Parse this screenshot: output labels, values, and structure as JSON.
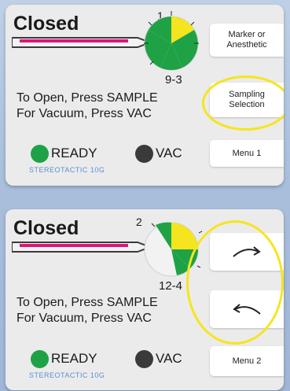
{
  "panels": [
    {
      "status_title": "Closed",
      "dial_top_label": "1",
      "dial_range_label": "9-3",
      "instruction_line1": "To Open, Press SAMPLE",
      "instruction_line2": "For Vacuum, Press VAC",
      "ready_label": "READY",
      "vac_label": "VAC",
      "brand_label": "STEREOTACTIC 10G",
      "buttons": [
        {
          "line1": "Marker or",
          "line2": "Anesthetic"
        },
        {
          "line1": "Sampling",
          "line2": "Selection"
        },
        {
          "label": "Menu 1"
        }
      ]
    },
    {
      "status_title": "Closed",
      "dial_top_label": "2",
      "dial_range_label": "12-4",
      "instruction_line1": "To Open, Press SAMPLE",
      "instruction_line2": "For Vacuum, Press VAC",
      "ready_label": "READY",
      "vac_label": "VAC",
      "brand_label": "STEREOTACTIC 10G",
      "buttons": [
        {
          "icon": "arrow-clockwise-icon"
        },
        {
          "icon": "arrow-counterclockwise-icon"
        },
        {
          "label": "Menu 2"
        }
      ]
    }
  ],
  "colors": {
    "ready": "#1fa246",
    "vac": "#3a3a3a",
    "dial_green": "#1fa246",
    "dial_yellow": "#f4e51e",
    "probe_pink": "#e0157a",
    "highlight": "#f6e51d"
  }
}
